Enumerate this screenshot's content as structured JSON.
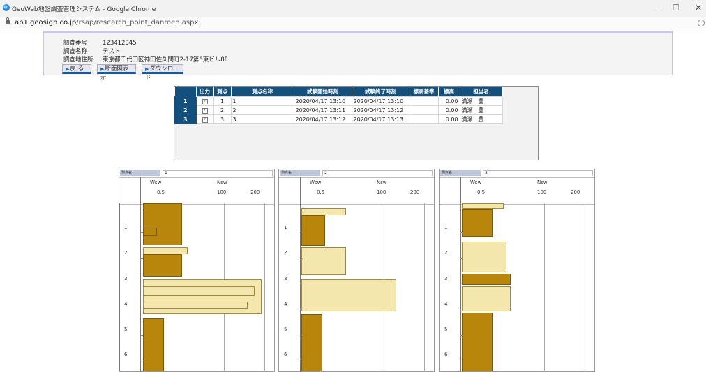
{
  "window": {
    "title": "GeoWeb地盤調査管理システム - Google Chrome",
    "url_host": "ap1.geosign.co.jp",
    "url_path": "/rsap/research_point_danmen.aspx",
    "minimize": "—",
    "maximize": "☐",
    "close": "✕"
  },
  "survey": {
    "number_label": "調査番号",
    "number_value": "123412345",
    "name_label": "調査名称",
    "name_value": "テスト",
    "address_label": "調査地住所",
    "address_value": "東京都千代田区神田佐久間町2-17第6東ビル8F"
  },
  "buttons": {
    "back": "戻 る",
    "section_view": "断面図表示",
    "download": "ダウンロード"
  },
  "table": {
    "headers": [
      "",
      "出力",
      "測点",
      "測点名称",
      "試験開始時刻",
      "試験終了時刻",
      "標高基準",
      "標高",
      "担当者"
    ],
    "rows": [
      {
        "no": "1",
        "point": "1",
        "name": "1",
        "start": "2020/04/17 13:10",
        "end": "2020/04/17 13:10",
        "base": "",
        "elev": "0.00",
        "person": "滿瀬　豊"
      },
      {
        "no": "2",
        "point": "2",
        "name": "2",
        "start": "2020/04/17 13:11",
        "end": "2020/04/17 13:12",
        "base": "",
        "elev": "0.00",
        "person": "滿瀬　豊"
      },
      {
        "no": "3",
        "point": "3",
        "name": "3",
        "start": "2020/04/17 13:12",
        "end": "2020/04/17 13:13",
        "base": "",
        "elev": "0.00",
        "person": "滿瀬　豊"
      }
    ]
  },
  "panels": [
    {
      "label": "測点名",
      "name": "1"
    },
    {
      "label": "測点名",
      "name": "2"
    },
    {
      "label": "測点名",
      "name": "3"
    }
  ],
  "scale": {
    "wsw": "Wsw",
    "wsw_tick": "0.5",
    "nsw": "Nsw",
    "nsw_tick1": "100",
    "nsw_tick2": "200"
  },
  "depths": [
    "1",
    "2",
    "3",
    "4",
    "5",
    "6"
  ],
  "colors": {
    "wsw_bar": "#b8860b",
    "nsw_bar": "#f3e7ad",
    "header_blue": "#14507e"
  }
}
